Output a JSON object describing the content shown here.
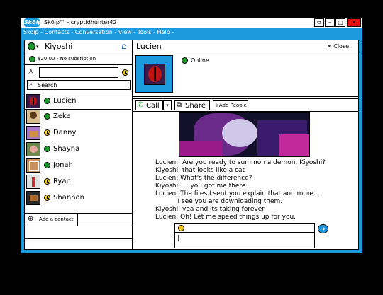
{
  "window": {
    "title": "Skōip™ - cryptidhunter42",
    "logo": "Skōip"
  },
  "menu": [
    "Skoip",
    "Contacts",
    "Conversation",
    "View",
    "Tools",
    "Help"
  ],
  "user": {
    "name": "Kiyoshi",
    "balance": "$20.00 - No subsription"
  },
  "search": {
    "placeholder": "Search"
  },
  "contacts": [
    {
      "name": "Lucien",
      "status": "online"
    },
    {
      "name": "Zeke",
      "status": "online"
    },
    {
      "name": "Danny",
      "status": "away"
    },
    {
      "name": "Shayna",
      "status": "online"
    },
    {
      "name": "Jonah",
      "status": "online"
    },
    {
      "name": "Ryan",
      "status": "away"
    },
    {
      "name": "Shannon",
      "status": "away"
    }
  ],
  "add_contact": "Add a contact",
  "chat": {
    "name": "Lucien",
    "close": "Close",
    "status": "Online",
    "call": "Call",
    "share": "Share",
    "add_people": "+Add People",
    "messages": [
      "Lucien:  Are you ready to summon a demon, Kiyoshi?",
      "Kiyoshi: that looks like a cat",
      "Lucien: What's the difference?",
      "Kiyoshi: ... you got me there",
      "Lucien: The files I sent you explain that and more...",
      "           I see you are downloading them.",
      "Kiyoshi: yea and its taking forever",
      "Lucien: Oh! Let me speed things up for you."
    ],
    "input_value": "|"
  },
  "colors": {
    "frame": "#1c9ae0",
    "online": "#1c9a2c",
    "away": "#f2c818",
    "close": "#e01010"
  }
}
